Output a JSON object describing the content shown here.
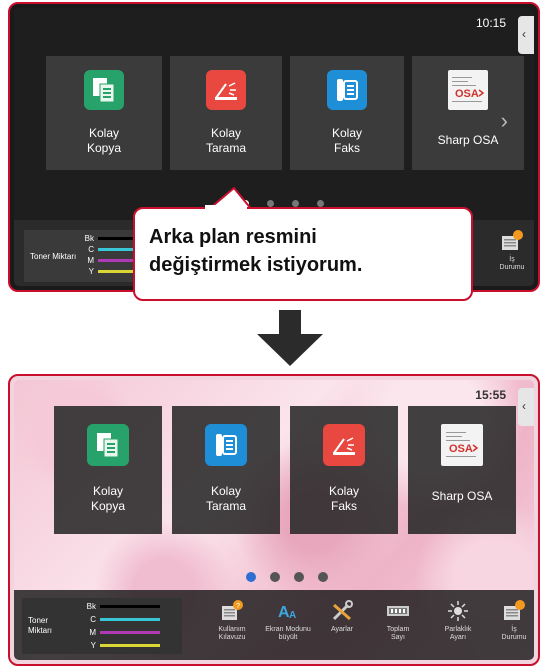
{
  "top_screen": {
    "time": "10:15",
    "side_tab_glyph": "‹",
    "tiles": [
      {
        "name": "copy",
        "line1": "Kolay",
        "line2": "Kopya",
        "icon": "copy-icon",
        "color": "#26a26a"
      },
      {
        "name": "scan",
        "line1": "Kolay",
        "line2": "Tarama",
        "icon": "scan-icon",
        "color": "#e8483f"
      },
      {
        "name": "fax",
        "line1": "Kolay",
        "line2": "Faks",
        "icon": "fax-icon",
        "color": "#1e8fd6"
      },
      {
        "name": "osa",
        "line1": "Sharp OSA",
        "line2": "",
        "icon": "osa-icon"
      }
    ],
    "next_glyph": "›",
    "toner_label": "Toner Miktarı",
    "job_status": {
      "line1": "İş",
      "line2": "Durumu"
    }
  },
  "callout": {
    "line1": "Arka plan resmini",
    "line2": "değiştirmek istiyorum."
  },
  "bottom_screen": {
    "time": "15:55",
    "side_tab_glyph": "‹",
    "tiles": [
      {
        "name": "copy",
        "line1": "Kolay",
        "line2": "Kopya",
        "icon": "copy-icon",
        "color": "#26a26a"
      },
      {
        "name": "scan",
        "line1": "Kolay",
        "line2": "Tarama",
        "icon": "fax-icon",
        "color": "#1e8fd6"
      },
      {
        "name": "fax",
        "line1": "Kolay",
        "line2": "Faks",
        "icon": "scan-icon",
        "color": "#e8483f"
      },
      {
        "name": "osa",
        "line1": "Sharp OSA",
        "line2": "",
        "icon": "osa-icon"
      }
    ],
    "toner_label_line1": "Toner",
    "toner_label_line2": "Miktarı",
    "bottom_buttons": [
      {
        "name": "user-guide",
        "line1": "Kullanım",
        "line2": "Kılavuzu",
        "icon": "manual-icon"
      },
      {
        "name": "zoom-screen",
        "line1": "Ekran Modunu",
        "line2": "büyült",
        "icon": "text-size-icon"
      },
      {
        "name": "settings",
        "line1": "Ayarlar",
        "line2": "",
        "icon": "tools-icon"
      },
      {
        "name": "total-count",
        "line1": "Toplam",
        "line2": "Sayı",
        "icon": "counter-icon"
      },
      {
        "name": "brightness",
        "line1": "Parlaklık",
        "line2": "Ayarı",
        "icon": "brightness-icon"
      },
      {
        "name": "job-status",
        "line1": "İş",
        "line2": "Durumu",
        "icon": "job-status-icon"
      }
    ]
  },
  "toner_channels": [
    {
      "label": "Bk",
      "color": "#000000"
    },
    {
      "label": "C",
      "color": "#39c6d6"
    },
    {
      "label": "M",
      "color": "#b03ab5"
    },
    {
      "label": "Y",
      "color": "#d9d635"
    }
  ],
  "osa_logo_text": "OSA"
}
